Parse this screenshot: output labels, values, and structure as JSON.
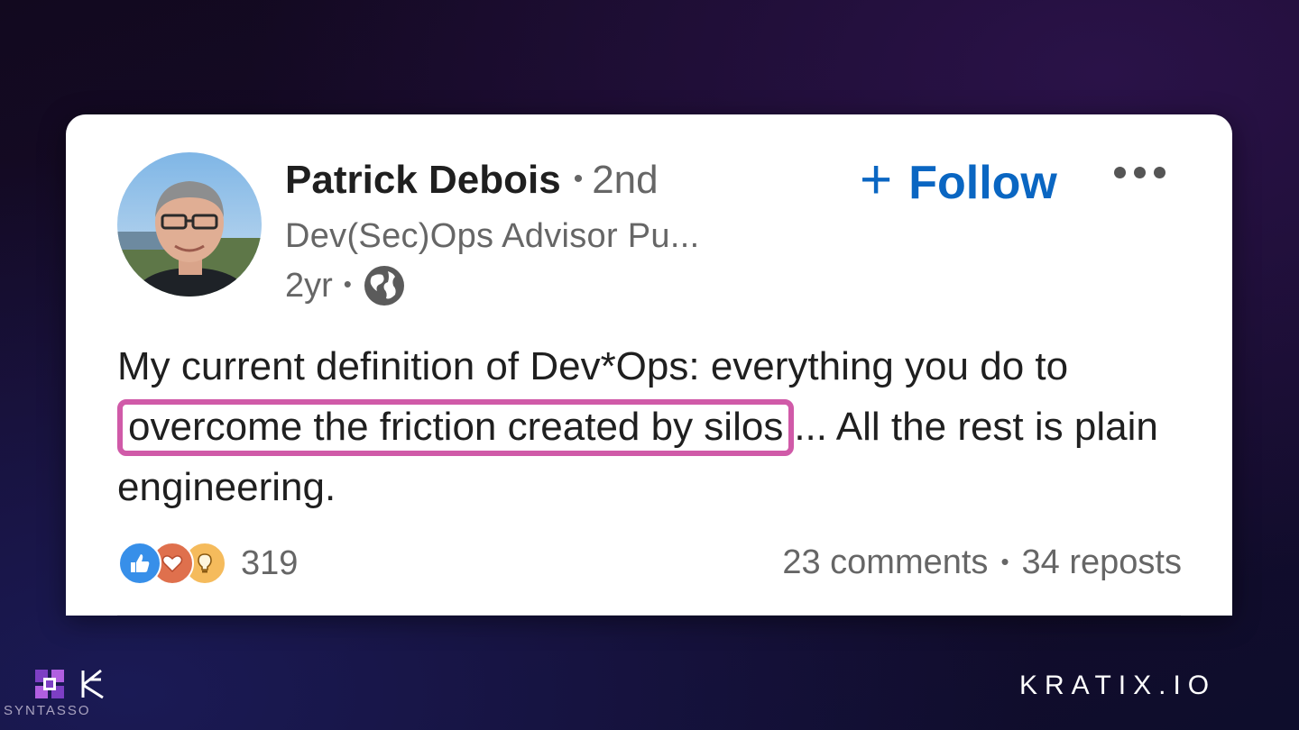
{
  "post": {
    "author": {
      "name": "Patrick Debois",
      "connection_degree": "2nd",
      "headline": "Dev(Sec)Ops Advisor Pu...",
      "time_ago": "2yr",
      "visibility_icon": "globe-icon"
    },
    "follow_label": "Follow",
    "more_icon": "more-options-icon",
    "text": {
      "part1": "My current definition of Dev*Ops: everything you do to ",
      "highlight": "overcome the friction created by silos",
      "part2": "... All the rest is plain engineering."
    },
    "highlight_color": "#d05aa8",
    "reactions": {
      "icons": [
        "like-icon",
        "love-icon",
        "insightful-icon"
      ],
      "count": "319"
    },
    "comments": "23 comments",
    "reposts": "34 reposts"
  },
  "colors": {
    "follow_blue": "#0a66c2",
    "background": "#12091f"
  },
  "footer": {
    "left_brand": "SYNTASSO",
    "right_brand": "KRATIX.IO"
  }
}
